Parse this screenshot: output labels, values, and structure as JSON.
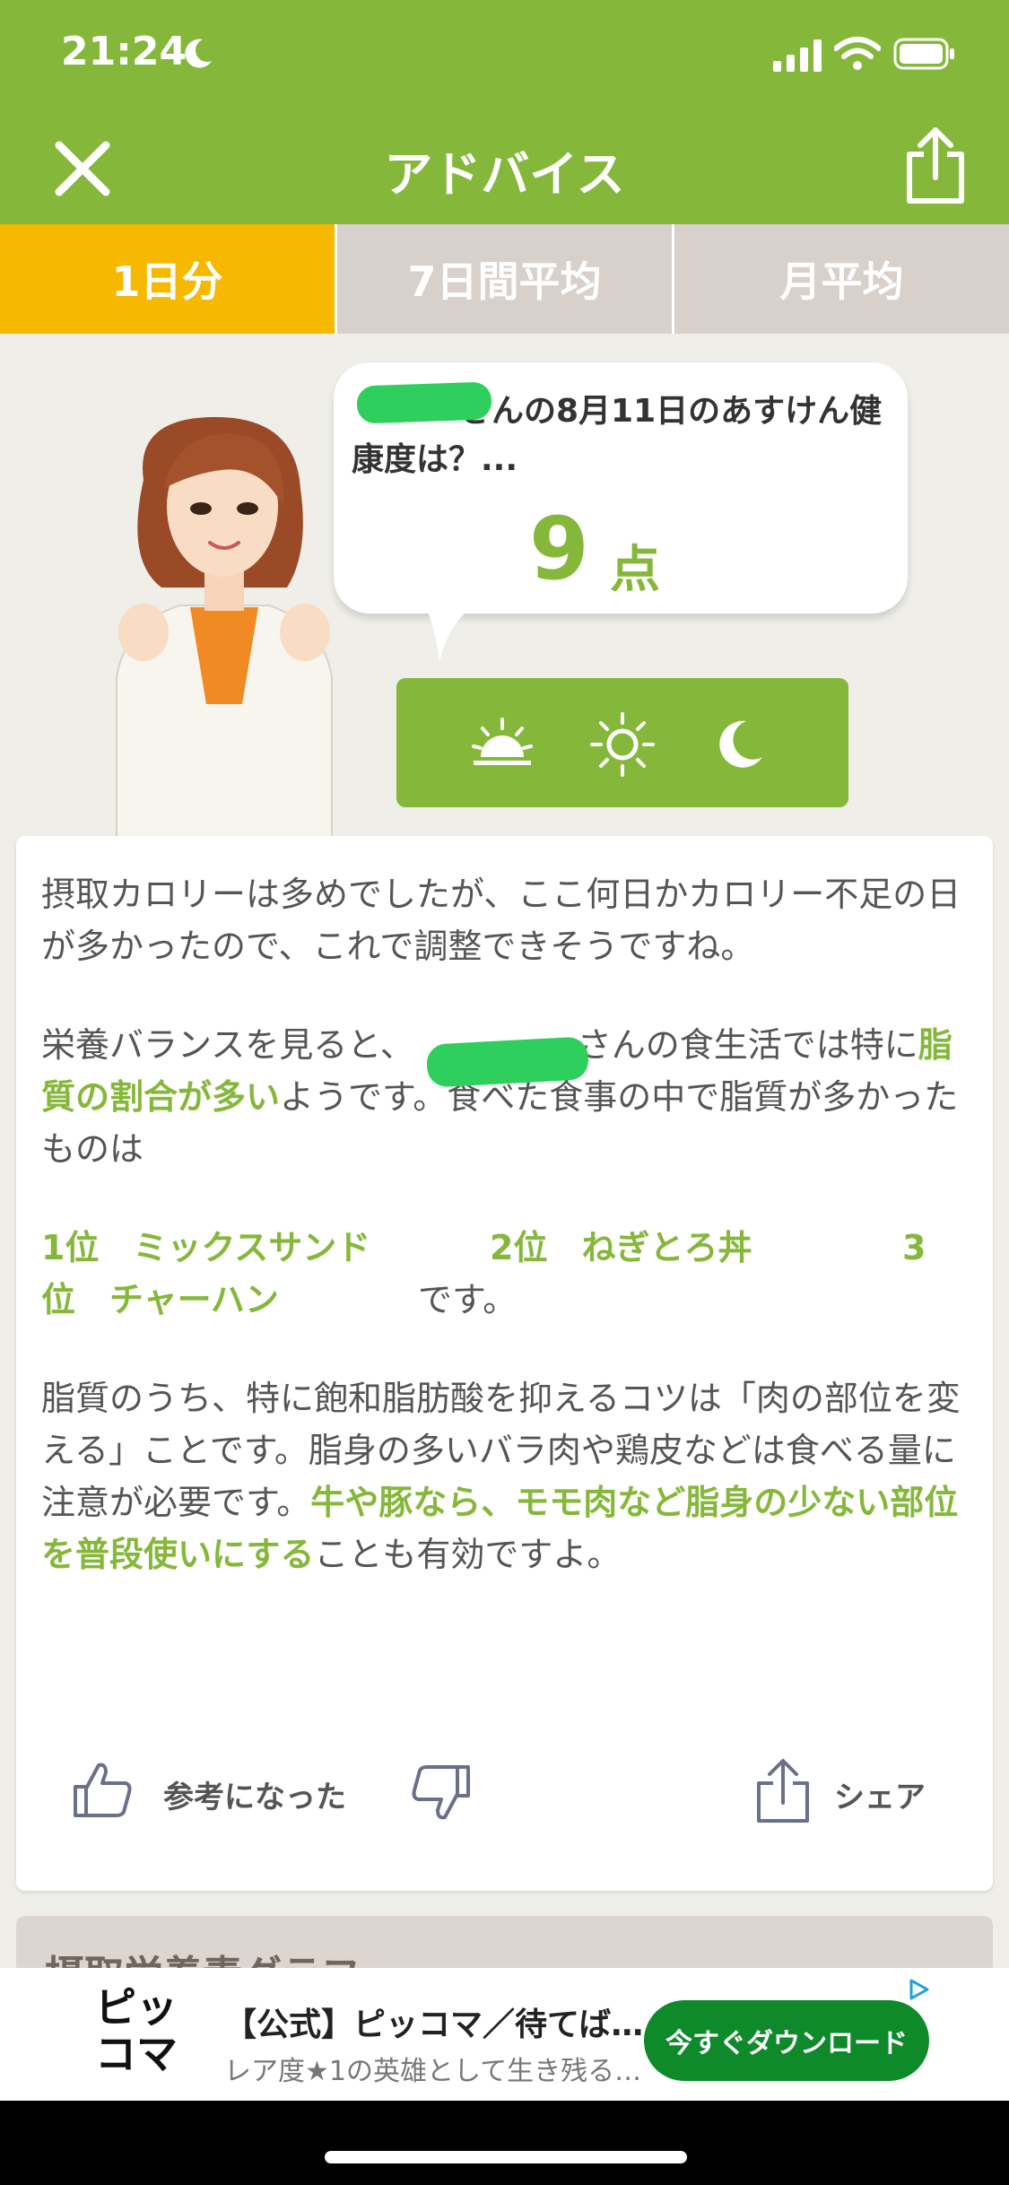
{
  "status_bar": {
    "time": "21:24"
  },
  "header": {
    "title": "アドバイス"
  },
  "tabs": [
    {
      "label": "1日分",
      "active": true
    },
    {
      "label": "7日間平均",
      "active": false
    },
    {
      "label": "月平均",
      "active": false
    }
  ],
  "bubble": {
    "text_after_name": "さんの8月11日のあすけん健康度は？...",
    "score": "9",
    "score_unit": "点"
  },
  "time_icons": [
    "sunrise-icon",
    "sun-icon",
    "moon-icon"
  ],
  "advice": {
    "p1": "摂取カロリーは多めでしたが、ここ何日かカロリー不足の日が多かったので、これで調整できそうですね。",
    "p2_prefix": "栄養バランスを見ると、",
    "p2_after_name": "さんの食生活では特に",
    "p2_highlight": "脂質の割合が多い",
    "p2_suffix": "ようです。食べた食事の中で脂質が多かったものは",
    "rank1": "1位　ミックスサンド",
    "rank2": "2位　ねぎとろ丼",
    "rank3_a": "3",
    "rank3_b": "位　チャーハン",
    "rank_suffix": "です。",
    "p4_prefix": "脂質のうち、特に飽和脂肪酸を抑えるコツは「肉の部位を変える」ことです。脂身の多いバラ肉や鶏皮などは食べる量に注意が必要です。",
    "p4_highlight": "牛や豚なら、モモ肉など脂身の少ない部位を普段使いにする",
    "p4_suffix": "ことも有効ですよ。"
  },
  "actions": {
    "helpful_label": "参考になった",
    "share_label": "シェア"
  },
  "next_section": {
    "label": "摂取栄養素グラフ"
  },
  "ad": {
    "logo_text_top": "ピッ",
    "logo_text_bottom": "コマ",
    "title": "【公式】ピッコマ／待てば…",
    "subtitle": "レア度★1の英雄として生き残る…",
    "button": "今すぐダウンロード"
  },
  "colors": {
    "brand_green": "#85b83a",
    "tab_active": "#f7b900",
    "tab_inactive": "#d7d0cb",
    "ad_button": "#0e8a2b"
  }
}
